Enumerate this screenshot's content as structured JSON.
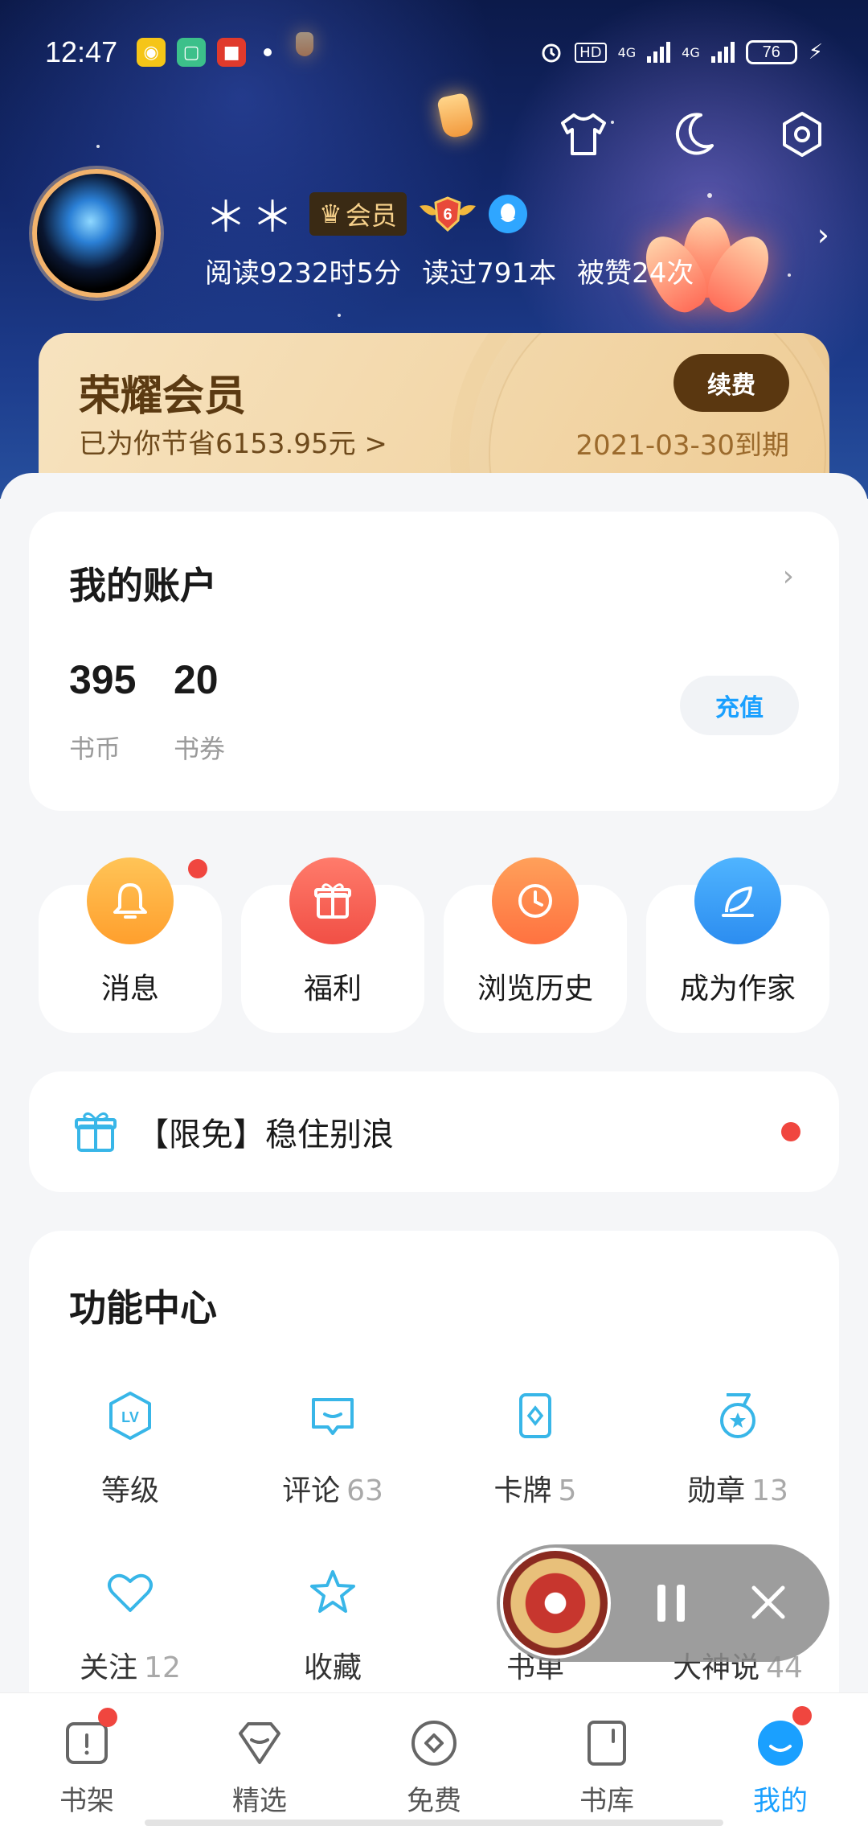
{
  "status_bar": {
    "time": "12:47",
    "hd_label": "HD",
    "network_1": "4G",
    "network_2": "4G",
    "battery": "76"
  },
  "profile": {
    "name": "＊＊",
    "vip_label": "会员",
    "level": "6",
    "read_time": "阅读9232时5分",
    "books_read": "读过791本",
    "likes": "被赞24次"
  },
  "vip_card": {
    "title": "荣耀会员",
    "saved": "已为你节省6153.95元 >",
    "renew_label": "续费",
    "expiry": "2021-03-30到期"
  },
  "account": {
    "title": "我的账户",
    "coins_value": "395",
    "coins_label": "书币",
    "vouchers_value": "20",
    "vouchers_label": "书券",
    "recharge_label": "充值"
  },
  "quick_actions": [
    {
      "label": "消息",
      "color": "#ffb13b"
    },
    {
      "label": "福利",
      "color": "#f5675a"
    },
    {
      "label": "浏览历史",
      "color": "#ff8a4a"
    },
    {
      "label": "成为作家",
      "color": "#3aa0f5"
    }
  ],
  "promo": {
    "text": "【限免】稳住别浪"
  },
  "function_center": {
    "title": "功能中心",
    "items": [
      {
        "label": "等级",
        "count": ""
      },
      {
        "label": "评论",
        "count": "63"
      },
      {
        "label": "卡牌",
        "count": "5"
      },
      {
        "label": "勋章",
        "count": "13"
      },
      {
        "label": "关注",
        "count": "12"
      },
      {
        "label": "收藏",
        "count": ""
      },
      {
        "label": "书单",
        "count": ""
      },
      {
        "label": "大神说",
        "count": "44"
      }
    ]
  },
  "bottom_nav": [
    {
      "label": "书架"
    },
    {
      "label": "精选"
    },
    {
      "label": "免费"
    },
    {
      "label": "书库"
    },
    {
      "label": "我的"
    }
  ],
  "colors": {
    "accent": "#1aa0ff",
    "badge_red": "#f0463f",
    "vip_brown": "#5a3710"
  }
}
